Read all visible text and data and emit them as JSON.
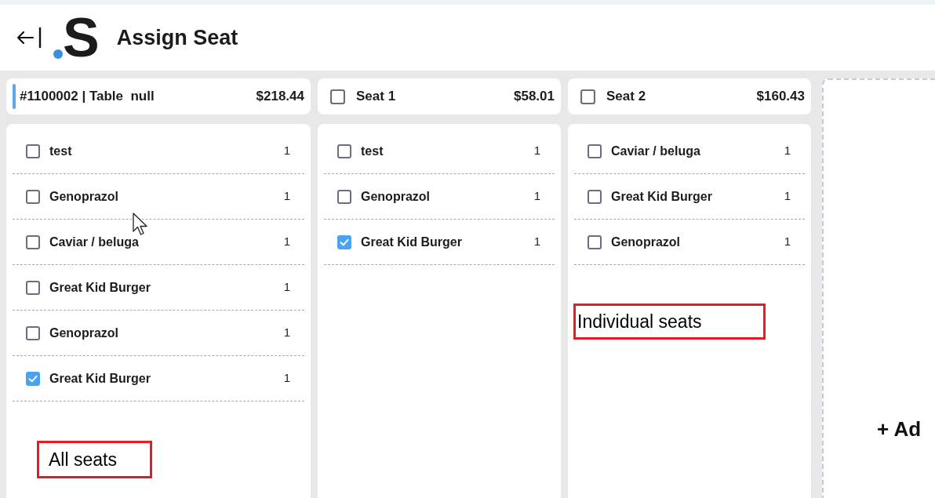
{
  "header": {
    "logo": "S",
    "title": "Assign Seat"
  },
  "columns": [
    {
      "kind": "order",
      "title": "#1100002 | Table  null",
      "total": "$218.44",
      "items": [
        {
          "name": "test",
          "quantity": "1",
          "checked": false
        },
        {
          "name": "Genoprazol",
          "quantity": "1",
          "checked": false
        },
        {
          "name": "Caviar / beluga",
          "quantity": "1",
          "checked": false
        },
        {
          "name": "Great Kid Burger",
          "quantity": "1",
          "checked": false
        },
        {
          "name": "Genoprazol",
          "quantity": "1",
          "checked": false
        },
        {
          "name": "Great Kid Burger",
          "quantity": "1",
          "checked": true
        }
      ]
    },
    {
      "kind": "seat",
      "title": "Seat 1",
      "checked": false,
      "total": "$58.01",
      "items": [
        {
          "name": "test",
          "quantity": "1",
          "checked": false
        },
        {
          "name": "Genoprazol",
          "quantity": "1",
          "checked": false
        },
        {
          "name": "Great Kid Burger",
          "quantity": "1",
          "checked": true
        }
      ]
    },
    {
      "kind": "seat",
      "title": "Seat 2",
      "checked": false,
      "total": "$160.43",
      "items": [
        {
          "name": "Caviar / beluga",
          "quantity": "1",
          "checked": false
        },
        {
          "name": "Great Kid Burger",
          "quantity": "1",
          "checked": false
        },
        {
          "name": "Genoprazol",
          "quantity": "1",
          "checked": false
        }
      ]
    }
  ],
  "add_seat": {
    "label": "+ Ad"
  },
  "annotations": [
    {
      "text": "All seats"
    },
    {
      "text": "Individual seats"
    }
  ]
}
